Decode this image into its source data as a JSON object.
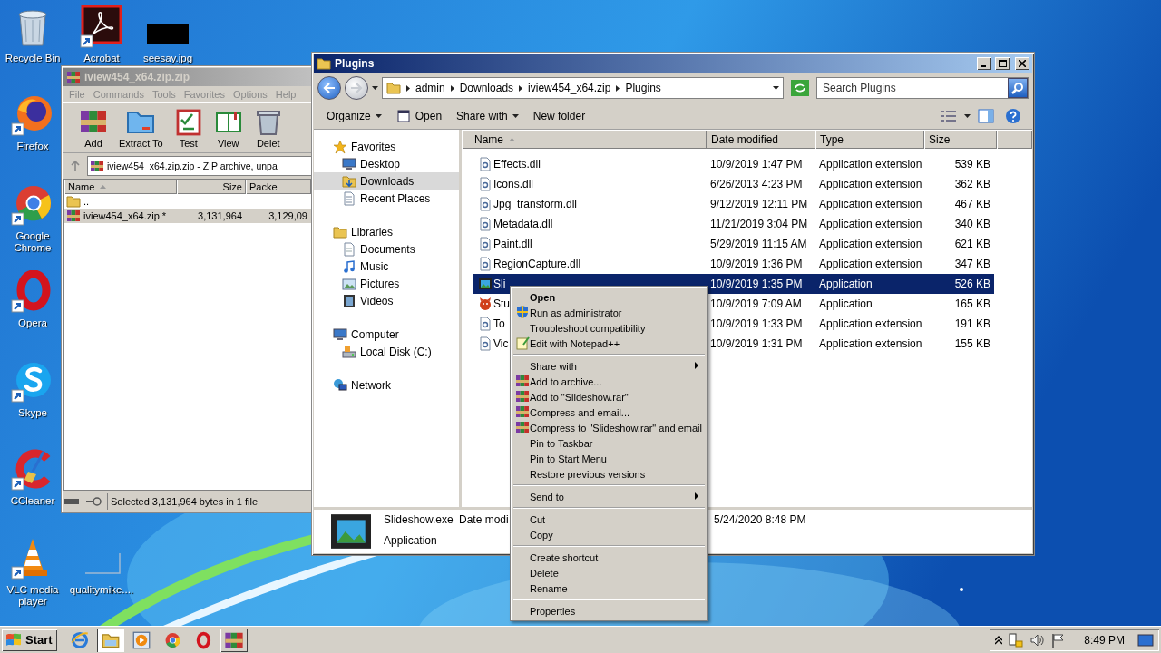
{
  "desktop": {
    "icons": [
      {
        "label": "Recycle Bin"
      },
      {
        "label": "Acrobat"
      },
      {
        "label": "seesay.jpg"
      },
      {
        "label": "Firefox"
      },
      {
        "label": "Google Chrome"
      },
      {
        "label": "Opera"
      },
      {
        "label": "Skype"
      },
      {
        "label": "CCleaner"
      },
      {
        "label": "VLC media player"
      },
      {
        "label": "qualitymike...."
      }
    ]
  },
  "winrar": {
    "title": "iview454_x64.zip.zip",
    "menu": [
      "File",
      "Commands",
      "Tools",
      "Favorites",
      "Options",
      "Help"
    ],
    "tools": [
      "Add",
      "Extract To",
      "Test",
      "View",
      "Delet"
    ],
    "path": "iview454_x64.zip.zip - ZIP archive, unpa",
    "columns": [
      {
        "label": "Name",
        "sorted": true
      },
      {
        "label": "Size",
        "sorted": false
      },
      {
        "label": "Packe",
        "sorted": false
      }
    ],
    "rows": [
      {
        "name": "..",
        "selected": false
      },
      {
        "name": "iview454_x64.zip *",
        "size": "3,131,964",
        "packed": "3,129,09",
        "selected": true
      }
    ],
    "status": "Selected 3,131,964 bytes in 1 file"
  },
  "explorer": {
    "title": "Plugins",
    "breadcrumbs": [
      "admin",
      "Downloads",
      "iview454_x64.zip",
      "Plugins"
    ],
    "search": {
      "placeholder": "Search Plugins"
    },
    "toolbar": [
      {
        "label": "Organize",
        "dropdown": true
      },
      {
        "label": "Open",
        "dropdown": false
      },
      {
        "label": "Share with",
        "dropdown": true
      },
      {
        "label": "New folder",
        "dropdown": false
      }
    ],
    "nav": [
      {
        "label": "Favorites",
        "selected": false,
        "children": [
          {
            "label": "Desktop",
            "selected": false
          },
          {
            "label": "Downloads",
            "selected": true
          },
          {
            "label": "Recent Places",
            "selected": false
          }
        ]
      },
      {
        "label": "Libraries",
        "selected": false,
        "children": [
          {
            "label": "Documents",
            "selected": false
          },
          {
            "label": "Music",
            "selected": false
          },
          {
            "label": "Pictures",
            "selected": false
          },
          {
            "label": "Videos",
            "selected": false
          }
        ]
      },
      {
        "label": "Computer",
        "selected": false,
        "children": [
          {
            "label": "Local Disk (C:)",
            "selected": false
          }
        ]
      },
      {
        "label": "Network",
        "selected": false
      }
    ],
    "columns": [
      {
        "label": "Name",
        "sorted": true
      },
      {
        "label": "Date modified",
        "sorted": false
      },
      {
        "label": "Type",
        "sorted": false
      },
      {
        "label": "Size",
        "sorted": false
      }
    ],
    "files": [
      {
        "name": "Effects.dll",
        "date": "10/9/2019 1:47 PM",
        "type": "Application extension",
        "size": "539 KB",
        "selected": false
      },
      {
        "name": "Icons.dll",
        "date": "6/26/2013 4:23 PM",
        "type": "Application extension",
        "size": "362 KB",
        "selected": false
      },
      {
        "name": "Jpg_transform.dll",
        "date": "9/12/2019 12:11 PM",
        "type": "Application extension",
        "size": "467 KB",
        "selected": false
      },
      {
        "name": "Metadata.dll",
        "date": "11/21/2019 3:04 PM",
        "type": "Application extension",
        "size": "340 KB",
        "selected": false
      },
      {
        "name": "Paint.dll",
        "date": "5/29/2019 11:15 AM",
        "type": "Application extension",
        "size": "621 KB",
        "selected": false
      },
      {
        "name": "RegionCapture.dll",
        "date": "10/9/2019 1:36 PM",
        "type": "Application extension",
        "size": "347 KB",
        "selected": false
      },
      {
        "name": "Sli",
        "date": "10/9/2019 1:35 PM",
        "type": "Application",
        "size": "526 KB",
        "selected": true
      },
      {
        "name": "Stu",
        "date": "10/9/2019 7:09 AM",
        "type": "Application",
        "size": "165 KB",
        "selected": false
      },
      {
        "name": "To",
        "date": "10/9/2019 1:33 PM",
        "type": "Application extension",
        "size": "191 KB",
        "selected": false
      },
      {
        "name": "Vic",
        "date": "10/9/2019 1:31 PM",
        "type": "Application extension",
        "size": "155 KB",
        "selected": false
      }
    ],
    "details": {
      "name": "Slideshow.exe",
      "date_label": "Date modi",
      "type": "Application",
      "date": "5/24/2020 8:48 PM"
    }
  },
  "context_menu": {
    "groups": [
      [
        {
          "label": "Open",
          "default": true,
          "submenu": false
        },
        {
          "label": "Run as administrator",
          "default": false,
          "submenu": false
        },
        {
          "label": "Troubleshoot compatibility",
          "default": false,
          "submenu": false
        },
        {
          "label": "Edit with Notepad++",
          "default": false,
          "submenu": false
        }
      ],
      [
        {
          "label": "Share with",
          "default": false,
          "submenu": true
        },
        {
          "label": "Add to archive...",
          "default": false,
          "submenu": false
        },
        {
          "label": "Add to \"Slideshow.rar\"",
          "default": false,
          "submenu": false
        },
        {
          "label": "Compress and email...",
          "default": false,
          "submenu": false
        },
        {
          "label": "Compress to \"Slideshow.rar\" and email",
          "default": false,
          "submenu": false
        },
        {
          "label": "Pin to Taskbar",
          "default": false,
          "submenu": false
        },
        {
          "label": "Pin to Start Menu",
          "default": false,
          "submenu": false
        },
        {
          "label": "Restore previous versions",
          "default": false,
          "submenu": false
        }
      ],
      [
        {
          "label": "Send to",
          "default": false,
          "submenu": true
        }
      ],
      [
        {
          "label": "Cut",
          "default": false,
          "submenu": false
        },
        {
          "label": "Copy",
          "default": false,
          "submenu": false
        }
      ],
      [
        {
          "label": "Create shortcut",
          "default": false,
          "submenu": false
        },
        {
          "label": "Delete",
          "default": false,
          "submenu": false
        },
        {
          "label": "Rename",
          "default": false,
          "submenu": false
        }
      ],
      [
        {
          "label": "Properties",
          "default": false,
          "submenu": false
        }
      ]
    ]
  },
  "taskbar": {
    "start": "Start",
    "apps": [
      {
        "selected": false,
        "running": false
      },
      {
        "selected": true,
        "running": true
      },
      {
        "selected": false,
        "running": false
      },
      {
        "selected": false,
        "running": false
      },
      {
        "selected": false,
        "running": false
      },
      {
        "selected": false,
        "running": true
      }
    ],
    "clock": "8:49 PM"
  }
}
